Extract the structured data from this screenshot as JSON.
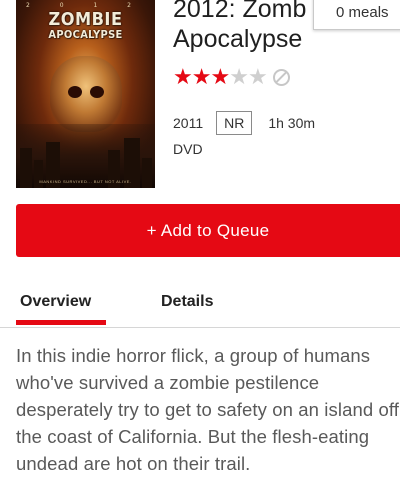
{
  "poster": {
    "year_text": "2 0 1 2",
    "title_line1": "ZOMBIE",
    "title_line2": "APOCALYPSE",
    "tagline": "MANKIND SURVIVED... BUT NOT ALIVE."
  },
  "movie": {
    "title_line1": "2012: Zomb",
    "title_line2": "Apocalypse",
    "rating_stars": 3,
    "rating_max": 5,
    "year": "2011",
    "mpaa_rating": "NR",
    "duration": "1h 30m",
    "format": "DVD"
  },
  "popup": {
    "meals_text": "0 meals"
  },
  "actions": {
    "add_to_queue_label": "+ Add to Queue"
  },
  "tabs": [
    {
      "label": "Overview",
      "active": true
    },
    {
      "label": "Details",
      "active": false
    }
  ],
  "synopsis": "In this indie horror flick, a group of humans who've survived a zombie pestilence desperately try to get to safety on an island off the coast of California. But the flesh-eating undead are hot on their trail.",
  "colors": {
    "accent": "#e50914",
    "star_off": "#cfcfcf",
    "text_muted": "#595959"
  },
  "icons": {
    "star": "star-icon",
    "not_interested": "not-interested-icon"
  }
}
